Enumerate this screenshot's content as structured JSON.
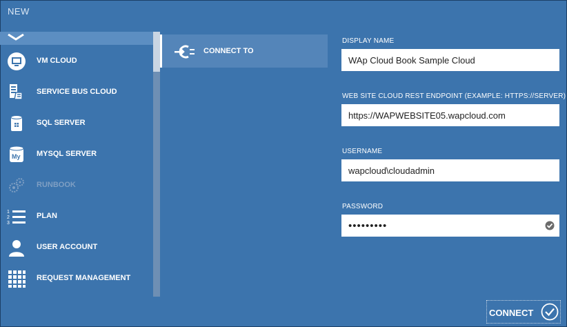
{
  "window": {
    "title": "NEW"
  },
  "nav": {
    "top_icon": "chevron-down-icon",
    "items": [
      {
        "label": "VM CLOUD",
        "icon": "monitor-icon",
        "enabled": true
      },
      {
        "label": "SERVICE BUS CLOUD",
        "icon": "service-bus-icon",
        "enabled": true
      },
      {
        "label": "SQL SERVER",
        "icon": "database-icon",
        "enabled": true
      },
      {
        "label": "MYSQL SERVER",
        "icon": "mysql-database-icon",
        "enabled": true
      },
      {
        "label": "RUNBOOK",
        "icon": "runbook-gears-icon",
        "enabled": false
      },
      {
        "label": "PLAN",
        "icon": "numbered-list-icon",
        "enabled": true
      },
      {
        "label": "USER ACCOUNT",
        "icon": "user-icon",
        "enabled": true
      },
      {
        "label": "REQUEST MANAGEMENT",
        "icon": "grid-icon",
        "enabled": true
      }
    ]
  },
  "middle": {
    "selected_label": "CONNECT TO",
    "selected_icon": "plug-connect-icon"
  },
  "form": {
    "display_name": {
      "label": "DISPLAY NAME",
      "value": "WAp Cloud Book Sample Cloud"
    },
    "endpoint": {
      "label": "WEB SITE CLOUD REST ENDPOINT (EXAMPLE: HTTPS://SERVER)",
      "value": "https://WAPWEBSITE05.wapcloud.com"
    },
    "username": {
      "label": "USERNAME",
      "value": "wapcloud\\cloudadmin"
    },
    "password": {
      "label": "PASSWORD",
      "value": "•••••••••",
      "status_icon": "check-circle-icon"
    }
  },
  "footer": {
    "connect_label": "CONNECT",
    "connect_icon": "checkmark-circle-icon"
  },
  "colors": {
    "background": "#3c74ad",
    "selected": "#5485b9",
    "text": "#ffffff"
  }
}
